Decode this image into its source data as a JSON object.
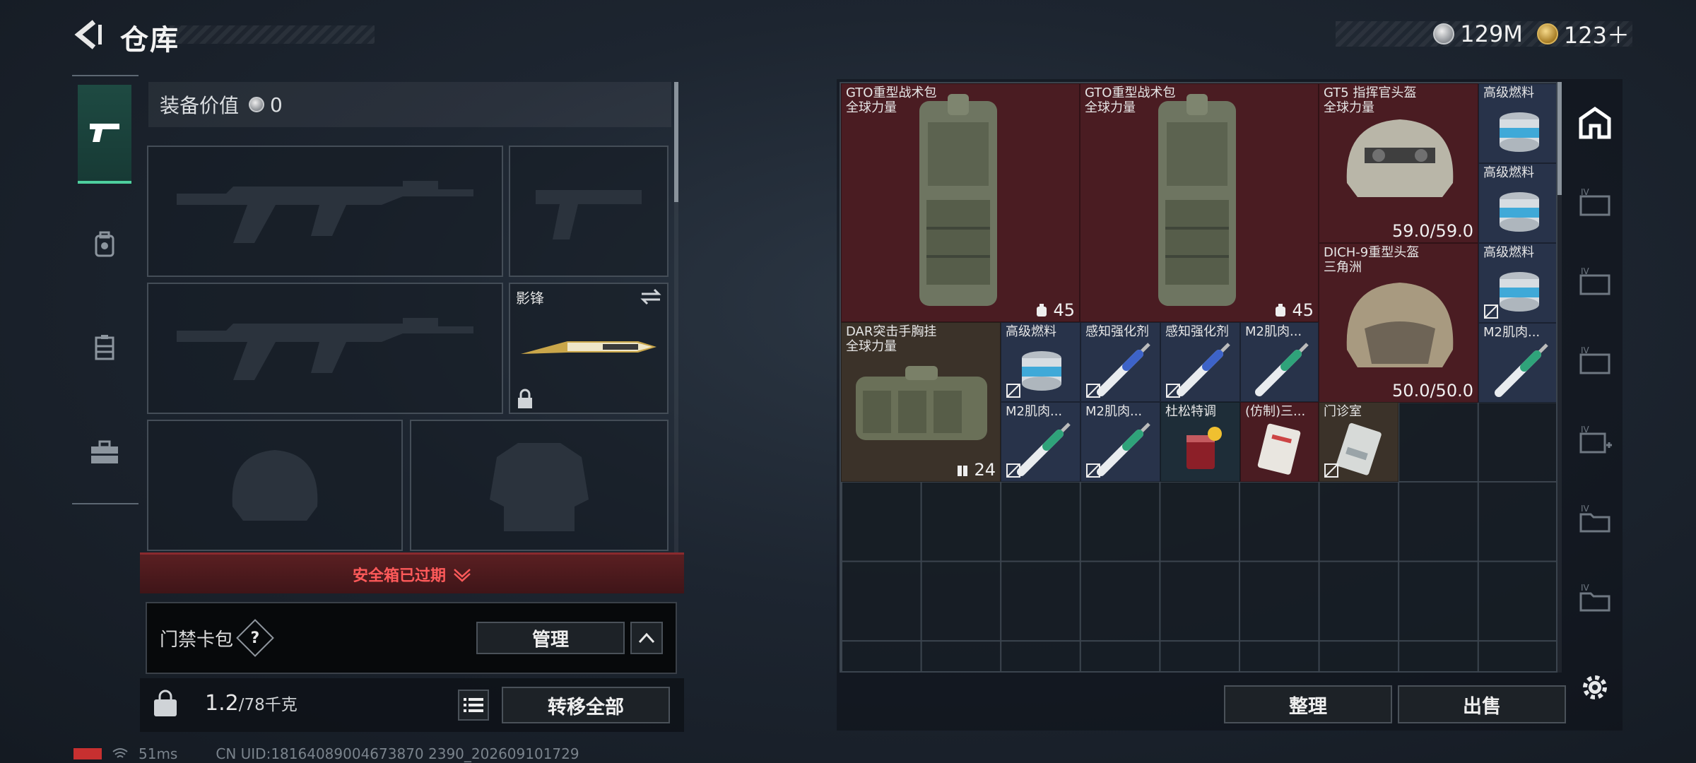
{
  "header": {
    "title": "仓库"
  },
  "currency": {
    "silver": "129M",
    "gold": "123＋"
  },
  "loadout": {
    "equip_value_label": "装备价值",
    "equip_value": "0",
    "melee_slot_label": "影锋",
    "safe_box_status": "安全箱已过期",
    "access_card_label": "门禁卡包",
    "help_mark": "?",
    "manage_label": "管理",
    "weight_current": "1.2",
    "weight_max": "/78千克",
    "transfer_all_label": "转移全部"
  },
  "status": {
    "ping": "51ms",
    "uid": "CN UID:18164089004673870 2390_202609101729"
  },
  "stash": {
    "items": [
      {
        "name": "GTO重型战术包",
        "sub": "全球力量",
        "qty": "45"
      },
      {
        "name": "GTO重型战术包",
        "sub": "全球力量",
        "qty": "45"
      },
      {
        "name": "GT5 指挥官头盔",
        "sub": "全球力量",
        "qty": "59.0/59.0"
      },
      {
        "name": "高级燃料"
      },
      {
        "name": "高级燃料"
      },
      {
        "name": "DICH-9重型头盔",
        "sub": "三角洲",
        "qty": "50.0/50.0"
      },
      {
        "name": "高级燃料"
      },
      {
        "name": "DAR突击手胸挂",
        "sub": "全球力量",
        "qty": "24"
      },
      {
        "name": "高级燃料"
      },
      {
        "name": "感知强化剂"
      },
      {
        "name": "感知强化剂"
      },
      {
        "name": "M2肌肉..."
      },
      {
        "name": "M2肌肉..."
      },
      {
        "name": "M2肌肉..."
      },
      {
        "name": "M2肌肉..."
      },
      {
        "name": "杜松特调"
      },
      {
        "name": "(仿制)三..."
      },
      {
        "name": "门诊室"
      }
    ],
    "sort_label": "整理",
    "sell_label": "出售"
  },
  "colors": {
    "accent_green": "#4ecf9e",
    "alert_red": "#ff5a5a",
    "rarity_red": "#4a1c22",
    "rarity_blue": "#28334a"
  },
  "icons": [
    "back-arrow-icon",
    "silver-coin-icon",
    "gold-coin-icon",
    "pistol-icon",
    "backpack-icon",
    "vest-icon",
    "toolbox-icon",
    "swap-icon",
    "lock-icon",
    "help-icon",
    "chevron-up-icon",
    "kg-lock-icon",
    "list-icon",
    "safehouse-icon",
    "gear-icon"
  ]
}
